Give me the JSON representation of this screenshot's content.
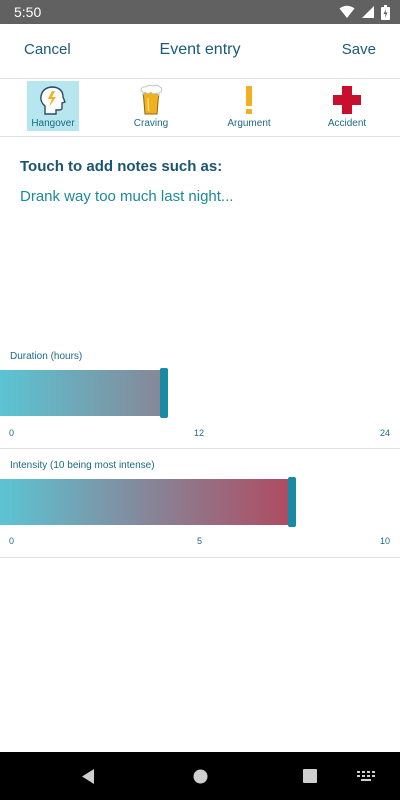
{
  "status": {
    "time": "5:50"
  },
  "app_bar": {
    "cancel_label": "Cancel",
    "title": "Event entry",
    "save_label": "Save"
  },
  "event_types": [
    {
      "label": "Hangover",
      "icon": "head-lightning-icon",
      "selected": true
    },
    {
      "label": "Craving",
      "icon": "beer-glass-icon",
      "selected": false
    },
    {
      "label": "Argument",
      "icon": "exclamation-icon",
      "selected": false
    },
    {
      "label": "Accident",
      "icon": "red-cross-icon",
      "selected": false
    }
  ],
  "notes": {
    "heading": "Touch to add notes such as:",
    "placeholder": "Drank way too much last night..."
  },
  "duration": {
    "label": "Duration (hours)",
    "min": 0,
    "max": 24,
    "value": 9.7,
    "ticks": [
      "0",
      "12",
      "24"
    ]
  },
  "intensity": {
    "label": "Intensity (10 being most intense)",
    "min": 0,
    "max": 10,
    "value": 7.2,
    "ticks": [
      "0",
      "5",
      "10"
    ]
  },
  "colors": {
    "accent": "#1a8aa2",
    "fill_start": "#5bc4d4",
    "fill_end_duration": "#868796",
    "fill_end_intensity": "#b04a60",
    "selected_bg": "#b7e6ee"
  }
}
